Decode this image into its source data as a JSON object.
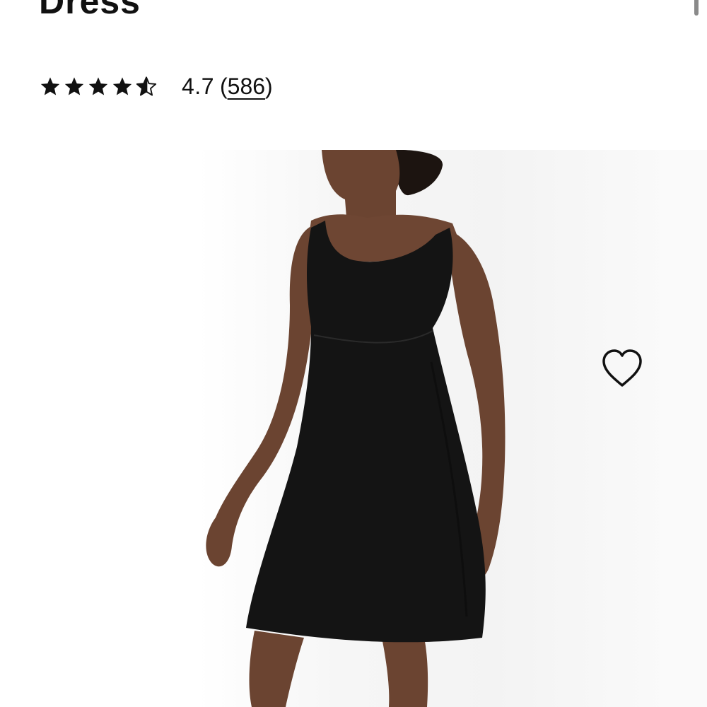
{
  "product": {
    "title": "Dress",
    "rating_value": "4.7",
    "review_count_open": "(",
    "review_count": "586",
    "review_count_close": ")",
    "rating_stars": 4.7,
    "rating_max": 5
  },
  "icons": {
    "rating": "star-icon",
    "wishlist": "heart-outline-icon"
  },
  "colors": {
    "text": "#111111",
    "dress": "#141414",
    "skin": "#6b4431"
  }
}
